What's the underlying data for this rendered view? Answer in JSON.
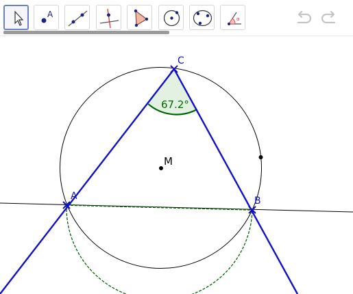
{
  "toolbar": {
    "tools": [
      {
        "name": "move-tool",
        "selected": true
      },
      {
        "name": "point-tool",
        "icon_letter": "A"
      },
      {
        "name": "line-tool"
      },
      {
        "name": "perpendicular-line-tool"
      },
      {
        "name": "polygon-tool"
      },
      {
        "name": "circle-center-point-tool"
      },
      {
        "name": "circle-through-points-tool"
      },
      {
        "name": "angle-tool",
        "icon_letter": "α"
      }
    ],
    "undo_icon": "undo-icon",
    "redo_icon": "redo-icon"
  },
  "construction": {
    "points": {
      "A": "A",
      "B": "B",
      "C": "C",
      "M": "M"
    },
    "angle_label": "67.2°",
    "colors": {
      "lines": "#1010c8",
      "angle": "#006600",
      "circle": "#000000",
      "selection_border": "#6d7fc9"
    }
  }
}
